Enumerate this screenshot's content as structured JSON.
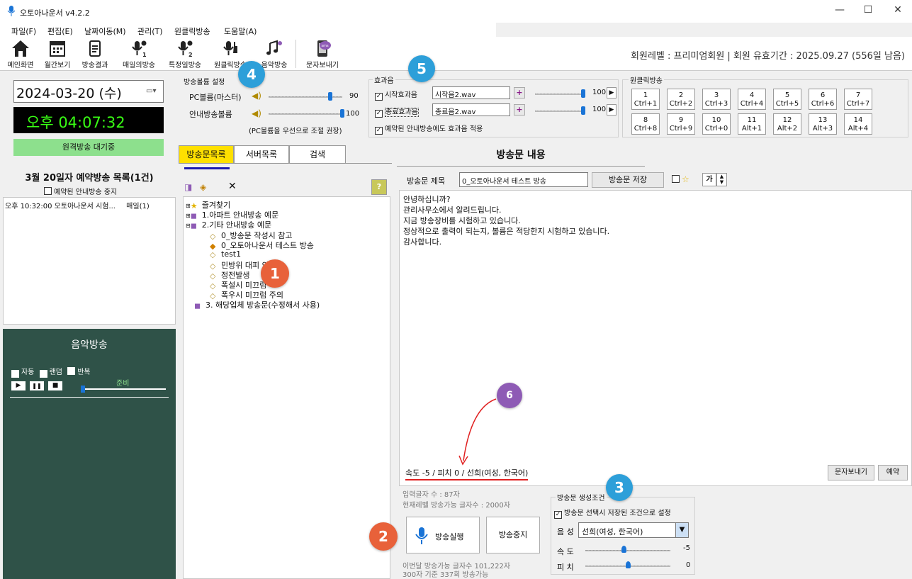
{
  "window": {
    "title": "오토아나운서 v4.2.2",
    "min": "—",
    "max": "☐",
    "close": "✕"
  },
  "menu": [
    "파일(F)",
    "편집(E)",
    "날짜이동(M)",
    "관리(T)",
    "원클릭방송",
    "도움말(A)"
  ],
  "toolbar": {
    "items": [
      "메인화면",
      "월간보기",
      "방송결과",
      "매일의방송",
      "특정일방송",
      "원클릭방송",
      "음악방송",
      "문자보내기"
    ],
    "sms_label": "sms"
  },
  "member": "회원레벨 : 프리미엄회원  |  회원 유효기간 : 2025.09.27 (556일 남음)",
  "left": {
    "date": "2024-03-20 (수)",
    "clock": "오후 04:07:32",
    "remote_status": "원격방송 대기중",
    "schedule_title": "3월 20일자 예약방송 목록(1건)",
    "stop_reserved_label": "예약된 안내방송 중지",
    "schedule_item_text": "오후 10:32:00  오토아나운서 시험...",
    "schedule_item_repeat": "매일(1)"
  },
  "music": {
    "title": "음악방송",
    "auto": "자동",
    "random": "랜덤",
    "repeat": "반복",
    "status": "준비"
  },
  "volume": {
    "title": "방송볼륨 설정",
    "pc_label": "PC볼륨(마스터)",
    "pc_value": "90",
    "pc_level": 0.9,
    "notice_label": "안내방송볼륨",
    "notice_value": "100",
    "notice_level": 1.0,
    "hint": "(PC볼륨을 우선으로 조절 권장)"
  },
  "effects": {
    "title": "효과음",
    "start_label": "시작효과음",
    "start_file": "시작음2.wav",
    "start_value": "100",
    "end_label": "종료효과음",
    "end_file": "종료음2.wav",
    "end_value": "100",
    "apply_reserved": "예약된 안내방송에도 효과음 적용"
  },
  "oneclick": {
    "title": "원클릭방송",
    "keys": [
      {
        "n": "1",
        "k": "Ctrl+1"
      },
      {
        "n": "2",
        "k": "Ctrl+2"
      },
      {
        "n": "3",
        "k": "Ctrl+3"
      },
      {
        "n": "4",
        "k": "Ctrl+4"
      },
      {
        "n": "5",
        "k": "Ctrl+5"
      },
      {
        "n": "6",
        "k": "Ctrl+6"
      },
      {
        "n": "7",
        "k": "Ctrl+7"
      },
      {
        "n": "8",
        "k": "Ctrl+8"
      },
      {
        "n": "9",
        "k": "Ctrl+9"
      },
      {
        "n": "10",
        "k": "Ctrl+0"
      },
      {
        "n": "11",
        "k": "Alt+1"
      },
      {
        "n": "12",
        "k": "Alt+2"
      },
      {
        "n": "13",
        "k": "Alt+3"
      },
      {
        "n": "14",
        "k": "Alt+4"
      }
    ]
  },
  "tabs": [
    "방송문목록",
    "서버목록",
    "검색"
  ],
  "tree": {
    "help": "?",
    "favorites": "즐겨찾기",
    "apt": "1.아파트 안내방송 예문",
    "etc": "2.기타 안내방송 예문",
    "c1": "0_방송문 작성시 참고",
    "c2": "0_오토아나운서 테스트 방송",
    "c3": "test1",
    "c4": "민방위 대피 안내",
    "c5": "정전발생",
    "c6": "폭설시 미끄럼",
    "c7": "폭우시 미끄럼 주의",
    "company": "3. 해당업체 방송문(수정해서 사용)"
  },
  "content": {
    "heading": "방송문 내용",
    "subject_label": "방송문 제목",
    "subject_value": "0_오토아나운서 테스트 방송",
    "save_button": "방송문 저장",
    "font_button": "가",
    "body": [
      "안녕하십니까?",
      "관리사무소에서 알려드립니다.",
      "지금 방송장비를 시험하고 있습니다.",
      "정상적으로 출력이 되는지, 볼륨은 적당한지 시험하고 있습니다.",
      "감사합니다."
    ],
    "voice_info": "속도 -5 / 피치 0 / 선희(여성, 한국어)",
    "sms_button": "문자보내기",
    "reserve_button": "예약"
  },
  "bottom": {
    "input_count": "입력글자 수 :  87자",
    "level_count": "현재레벨 방송가능 글자수 : 2000자",
    "play_button": "방송실행",
    "stop_button": "방송중지",
    "month_info": "이번달 방송가능 글자수 101,222자",
    "month_info2": "300자 기준 337회 방송가능",
    "cond_title": "방송문 생성조건",
    "cond_check": "방송문 선택시 저장된 조건으로 설정",
    "voice_label": "음 성",
    "voice_value": "선희(여성, 한국어)",
    "speed_label": "속 도",
    "speed_value": "-5",
    "speed_level": 0.45,
    "pitch_label": "피 치",
    "pitch_value": "0",
    "pitch_level": 0.5
  },
  "badges": [
    "1",
    "2",
    "3",
    "4",
    "5",
    "6"
  ],
  "colors": {
    "badge_orange": "#e8613a",
    "badge_blue": "#2d9fd9",
    "badge_purple": "#8e5bb5",
    "clock_green": "#39ff14",
    "music_bg": "#2f5248",
    "remote_green": "#8de08d"
  }
}
